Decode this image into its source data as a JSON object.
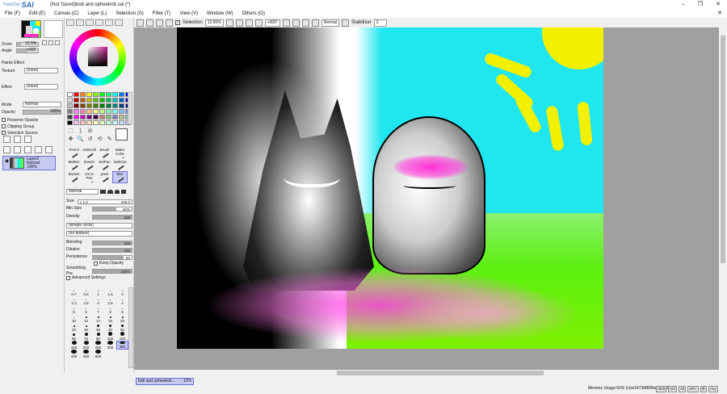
{
  "app": {
    "logo_small": "PaintTool",
    "logo_big": "SAI",
    "title": "(Not Saved)bob and opheebob.sai (*)",
    "win_buttons": [
      "–",
      "❐",
      "✕"
    ]
  },
  "menu": [
    "File (F)",
    "Edit (E)",
    "Canvas (C)",
    "Layer (L)",
    "Selection (S)",
    "Filter (T)",
    "View (V)",
    "Window (W)",
    "Others (O)"
  ],
  "menu_close": "✕",
  "toolbar": {
    "selection_label": "Selection",
    "zoom": "12.50%",
    "angle": "+000°",
    "blend": "Normal",
    "stabilizer_label": "Stabilizer",
    "stabilizer_value": "3"
  },
  "navigator": {
    "zoom_label": "Zoom",
    "zoom_value": "12.5%",
    "angle_label": "Angle",
    "angle_value": "+000"
  },
  "paper": {
    "header": "Paints Effect",
    "texture_label": "Texture",
    "texture_value": "(none)",
    "effect_label": "Effect",
    "effect_value": "(none)"
  },
  "layer_props": {
    "mode_label": "Mode",
    "mode_value": "Normal",
    "opacity_label": "Opacity",
    "opacity_value": "100%",
    "preserve": "Preserve Opacity",
    "clipping": "Clipping Group",
    "selection_source": "Selection Source"
  },
  "layer": {
    "name": "Layer2",
    "mode": "Normal",
    "opacity": "100%"
  },
  "swatch_colors": [
    "#ffffff",
    "#ff0000",
    "#ff8000",
    "#ffff00",
    "#80ff00",
    "#00ff00",
    "#00ff80",
    "#00ffff",
    "#0080ff",
    "#0000ff",
    "#e0e0e0",
    "#c00000",
    "#c06000",
    "#c0c000",
    "#60c000",
    "#00c000",
    "#00c060",
    "#00c0c0",
    "#0060c0",
    "#0000c0",
    "#c0c0c0",
    "#800000",
    "#804000",
    "#808000",
    "#408000",
    "#008000",
    "#008040",
    "#008080",
    "#004080",
    "#000080",
    "#808080",
    "#ff80ff",
    "#ff80c0",
    "#ffc080",
    "#ffff80",
    "#c0ff80",
    "#80ffc0",
    "#80ffff",
    "#80c0ff",
    "#8080ff",
    "#404040",
    "#ff00ff",
    "#c000c0",
    "#800080",
    "#400040",
    "#c08080",
    "#80c080",
    "#8080c0",
    "#c0c080",
    "#80c0c0",
    "#000000",
    "#ffc0ff",
    "#ffc0c0",
    "#ffe0c0",
    "#ffffc0",
    "#e0ffc0",
    "#c0ffe0",
    "#c0ffff",
    "#c0e0ff",
    "#c0c0ff"
  ],
  "sel_tools": [
    "⬚",
    "⟆",
    "⊘",
    "",
    "",
    "✥",
    "🔍",
    "↺",
    "⟲",
    "✎"
  ],
  "brushes": [
    {
      "name": "Pencil"
    },
    {
      "name": "AirBrush"
    },
    {
      "name": "Brush"
    },
    {
      "name": "Water Color"
    },
    {
      "name": "Marker"
    },
    {
      "name": "Eraser"
    },
    {
      "name": "SelPen"
    },
    {
      "name": "SelEras"
    },
    {
      "name": "Bucket"
    },
    {
      "name": "ick to Pen"
    },
    {
      "name": "pixel"
    },
    {
      "name": "Blur"
    }
  ],
  "brush_props": {
    "shape_mode": "Normal",
    "size_label": "Size",
    "size_mult": "x 1.0",
    "size_value": "200.0",
    "min_size_label": "Min Size",
    "min_size_value": "60%",
    "density_label": "Density",
    "density_value": "100",
    "shape_value": "(simple circle)",
    "texture_value": "(no texture)",
    "blending_label": "Blending",
    "blending_value": "100",
    "dilution_label": "Dilution",
    "dilution_value": "100",
    "persistence_label": "Persistence",
    "persistence_value": "80",
    "keep_opacity": "Keep Opacity",
    "smoothing_label": "Smoothing Pre",
    "smoothing_value": "100%",
    "advanced": "Advanced Settings"
  },
  "dot_sizes": [
    "0.7",
    "0.8",
    "1",
    "1.5",
    "2",
    "2.3",
    "2.6",
    "3",
    "3.5",
    "4",
    "5",
    "6",
    "7",
    "8",
    "9",
    "10",
    "12",
    "14",
    "16",
    "20",
    "25",
    "30",
    "35",
    "40",
    "50",
    "60",
    "70",
    "80",
    "100",
    "120",
    "160",
    "200",
    "250",
    "300",
    "350",
    "400",
    "450",
    "500"
  ],
  "status": {
    "doc_name": "bob and opheebob...",
    "doc_zoom": "12%",
    "memory": "Memory Usage:60% (Use2473MB/Max4095MB)",
    "keys": [
      "Shift",
      "Ctrl",
      "Alt",
      "SPC",
      "Ⓦ",
      "Any"
    ]
  }
}
